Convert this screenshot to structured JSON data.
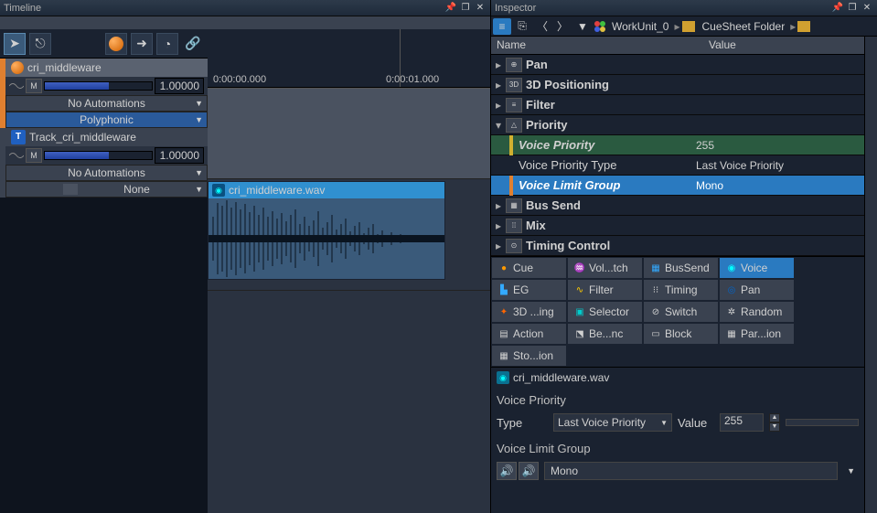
{
  "timeline": {
    "title": "Timeline",
    "ruler": {
      "t0": "0:00:00.000",
      "t1": "0:00:01.000"
    },
    "tracks": [
      {
        "name": "cri_middleware",
        "volume": "1.00000",
        "automations": "No Automations",
        "mode": "Polyphonic"
      },
      {
        "name": "Track_cri_middleware",
        "volume": "1.00000",
        "automations": "No Automations",
        "mode": "None"
      }
    ],
    "clip": {
      "filename": "cri_middleware.wav"
    }
  },
  "inspector": {
    "title": "Inspector",
    "breadcrumb": {
      "workunit": "WorkUnit_0",
      "folder": "CueSheet Folder"
    },
    "columns": {
      "name": "Name",
      "value": "Value"
    },
    "categories": [
      {
        "label": "Pan",
        "icon": "⊕"
      },
      {
        "label": "3D Positioning",
        "icon": "3D"
      },
      {
        "label": "Filter",
        "icon": "≡"
      },
      {
        "label": "Priority",
        "icon": "△",
        "expanded": true,
        "children": [
          {
            "label": "Voice Priority",
            "value": "255",
            "marker": "yellow",
            "italic": true,
            "highlight": "green"
          },
          {
            "label": "Voice Priority Type",
            "value": "Last Voice Priority"
          },
          {
            "label": "Voice Limit Group",
            "value": "Mono",
            "marker": "orange",
            "italic": true,
            "highlight": "blue"
          }
        ]
      },
      {
        "label": "Bus Send",
        "icon": "▦"
      },
      {
        "label": "Mix",
        "icon": "⁞⁞"
      },
      {
        "label": "Timing Control",
        "icon": "⊙"
      }
    ],
    "tabs": [
      {
        "label": "Cue",
        "icon": "●"
      },
      {
        "label": "Vol...tch",
        "icon": "♒"
      },
      {
        "label": "BusSend",
        "icon": "▦"
      },
      {
        "label": "Voice",
        "icon": "◉",
        "active": true
      },
      {
        "label": "EG",
        "icon": "▙"
      },
      {
        "label": "Filter",
        "icon": "∿"
      },
      {
        "label": "Timing",
        "icon": "⁝⁝"
      },
      {
        "label": "Pan",
        "icon": "◎"
      },
      {
        "label": "3D ...ing",
        "icon": "✦"
      },
      {
        "label": "Selector",
        "icon": "▣"
      },
      {
        "label": "Switch",
        "icon": "⊘"
      },
      {
        "label": "Random",
        "icon": "✲"
      },
      {
        "label": "Action",
        "icon": "▤"
      },
      {
        "label": "Be...nc",
        "icon": "⬔"
      },
      {
        "label": "Block",
        "icon": "▭"
      },
      {
        "label": "Par...ion",
        "icon": "▦"
      },
      {
        "label": "Sto...ion",
        "icon": "▦"
      }
    ],
    "detail": {
      "file": "cri_middleware.wav",
      "section1": "Voice Priority",
      "type_label": "Type",
      "type_value": "Last Voice Priority",
      "value_label": "Value",
      "value_num": "255",
      "section2": "Voice Limit Group",
      "group_value": "Mono"
    }
  }
}
